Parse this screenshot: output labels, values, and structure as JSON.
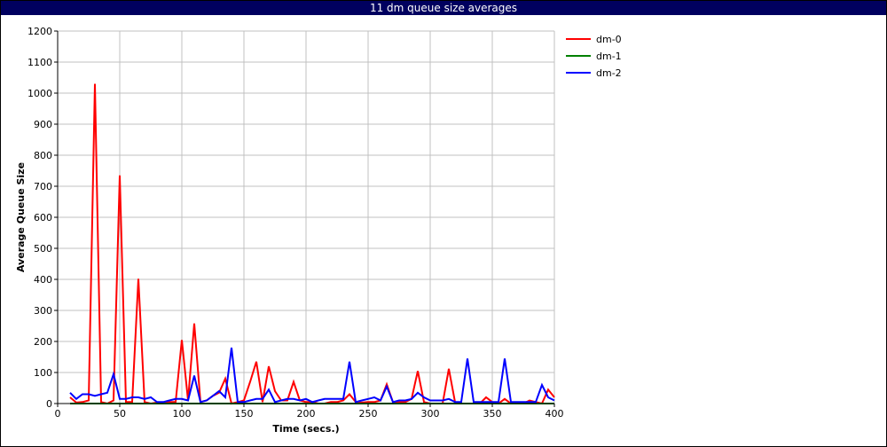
{
  "window": {
    "title": "11 dm queue size averages"
  },
  "chart_data": {
    "type": "line",
    "title": "11 dm queue size averages",
    "xlabel": "Time (secs.)",
    "ylabel": "Average Queue Size",
    "xlim": [
      0,
      400
    ],
    "ylim": [
      0,
      1200
    ],
    "x_ticks": [
      0,
      50,
      100,
      150,
      200,
      250,
      300,
      350,
      400
    ],
    "y_ticks": [
      0,
      100,
      200,
      300,
      400,
      500,
      600,
      700,
      800,
      900,
      1000,
      1100,
      1200
    ],
    "grid": true,
    "legend_position": "top-right, outside plot",
    "series": [
      {
        "name": "dm-0",
        "color": "#ff0000",
        "points": [
          [
            10,
            20
          ],
          [
            15,
            3
          ],
          [
            20,
            5
          ],
          [
            25,
            10
          ],
          [
            30,
            1030
          ],
          [
            35,
            5
          ],
          [
            40,
            0
          ],
          [
            45,
            10
          ],
          [
            50,
            735
          ],
          [
            55,
            5
          ],
          [
            60,
            5
          ],
          [
            65,
            402
          ],
          [
            70,
            5
          ],
          [
            75,
            0
          ],
          [
            80,
            3
          ],
          [
            85,
            3
          ],
          [
            90,
            5
          ],
          [
            95,
            5
          ],
          [
            100,
            205
          ],
          [
            105,
            10
          ],
          [
            110,
            258
          ],
          [
            115,
            5
          ],
          [
            120,
            10
          ],
          [
            125,
            25
          ],
          [
            130,
            35
          ],
          [
            135,
            80
          ],
          [
            140,
            0
          ],
          [
            145,
            5
          ],
          [
            150,
            10
          ],
          [
            155,
            70
          ],
          [
            160,
            135
          ],
          [
            165,
            5
          ],
          [
            170,
            120
          ],
          [
            175,
            40
          ],
          [
            180,
            10
          ],
          [
            185,
            10
          ],
          [
            190,
            70
          ],
          [
            195,
            10
          ],
          [
            200,
            5
          ],
          [
            205,
            5
          ],
          [
            210,
            0
          ],
          [
            215,
            0
          ],
          [
            220,
            5
          ],
          [
            225,
            5
          ],
          [
            230,
            10
          ],
          [
            235,
            30
          ],
          [
            240,
            5
          ],
          [
            245,
            3
          ],
          [
            250,
            5
          ],
          [
            255,
            5
          ],
          [
            260,
            10
          ],
          [
            265,
            62
          ],
          [
            270,
            5
          ],
          [
            275,
            5
          ],
          [
            280,
            5
          ],
          [
            285,
            15
          ],
          [
            290,
            105
          ],
          [
            295,
            5
          ],
          [
            300,
            0
          ],
          [
            305,
            0
          ],
          [
            310,
            0
          ],
          [
            315,
            112
          ],
          [
            320,
            5
          ],
          [
            325,
            0
          ],
          [
            330,
            0
          ],
          [
            335,
            0
          ],
          [
            340,
            0
          ],
          [
            345,
            20
          ],
          [
            350,
            5
          ],
          [
            355,
            0
          ],
          [
            360,
            15
          ],
          [
            365,
            0
          ],
          [
            370,
            0
          ],
          [
            375,
            0
          ],
          [
            380,
            10
          ],
          [
            385,
            5
          ],
          [
            390,
            0
          ],
          [
            395,
            45
          ],
          [
            400,
            20
          ]
        ]
      },
      {
        "name": "dm-1",
        "color": "#008000",
        "points": [
          [
            10,
            0
          ],
          [
            50,
            0
          ],
          [
            100,
            0
          ],
          [
            150,
            0
          ],
          [
            200,
            0
          ],
          [
            250,
            0
          ],
          [
            300,
            0
          ],
          [
            350,
            0
          ],
          [
            400,
            0
          ]
        ]
      },
      {
        "name": "dm-2",
        "color": "#0000ff",
        "points": [
          [
            10,
            35
          ],
          [
            15,
            15
          ],
          [
            20,
            30
          ],
          [
            25,
            30
          ],
          [
            30,
            25
          ],
          [
            35,
            30
          ],
          [
            40,
            35
          ],
          [
            45,
            95
          ],
          [
            50,
            15
          ],
          [
            55,
            15
          ],
          [
            60,
            20
          ],
          [
            65,
            20
          ],
          [
            70,
            15
          ],
          [
            75,
            20
          ],
          [
            80,
            5
          ],
          [
            85,
            5
          ],
          [
            90,
            10
          ],
          [
            95,
            15
          ],
          [
            100,
            15
          ],
          [
            105,
            10
          ],
          [
            110,
            90
          ],
          [
            115,
            5
          ],
          [
            120,
            10
          ],
          [
            125,
            25
          ],
          [
            130,
            40
          ],
          [
            135,
            20
          ],
          [
            140,
            180
          ],
          [
            145,
            5
          ],
          [
            150,
            5
          ],
          [
            155,
            10
          ],
          [
            160,
            15
          ],
          [
            165,
            15
          ],
          [
            170,
            45
          ],
          [
            175,
            5
          ],
          [
            180,
            10
          ],
          [
            185,
            15
          ],
          [
            190,
            15
          ],
          [
            195,
            10
          ],
          [
            200,
            15
          ],
          [
            205,
            5
          ],
          [
            210,
            10
          ],
          [
            215,
            15
          ],
          [
            220,
            15
          ],
          [
            225,
            15
          ],
          [
            230,
            15
          ],
          [
            235,
            135
          ],
          [
            240,
            5
          ],
          [
            245,
            10
          ],
          [
            250,
            15
          ],
          [
            255,
            20
          ],
          [
            260,
            10
          ],
          [
            265,
            55
          ],
          [
            270,
            5
          ],
          [
            275,
            10
          ],
          [
            280,
            10
          ],
          [
            285,
            15
          ],
          [
            290,
            35
          ],
          [
            295,
            20
          ],
          [
            300,
            10
          ],
          [
            305,
            10
          ],
          [
            310,
            10
          ],
          [
            315,
            15
          ],
          [
            320,
            5
          ],
          [
            325,
            5
          ],
          [
            330,
            145
          ],
          [
            335,
            5
          ],
          [
            340,
            5
          ],
          [
            345,
            5
          ],
          [
            350,
            5
          ],
          [
            355,
            5
          ],
          [
            360,
            145
          ],
          [
            365,
            5
          ],
          [
            370,
            5
          ],
          [
            375,
            5
          ],
          [
            380,
            5
          ],
          [
            385,
            5
          ],
          [
            390,
            60
          ],
          [
            395,
            20
          ],
          [
            400,
            10
          ]
        ]
      }
    ]
  }
}
